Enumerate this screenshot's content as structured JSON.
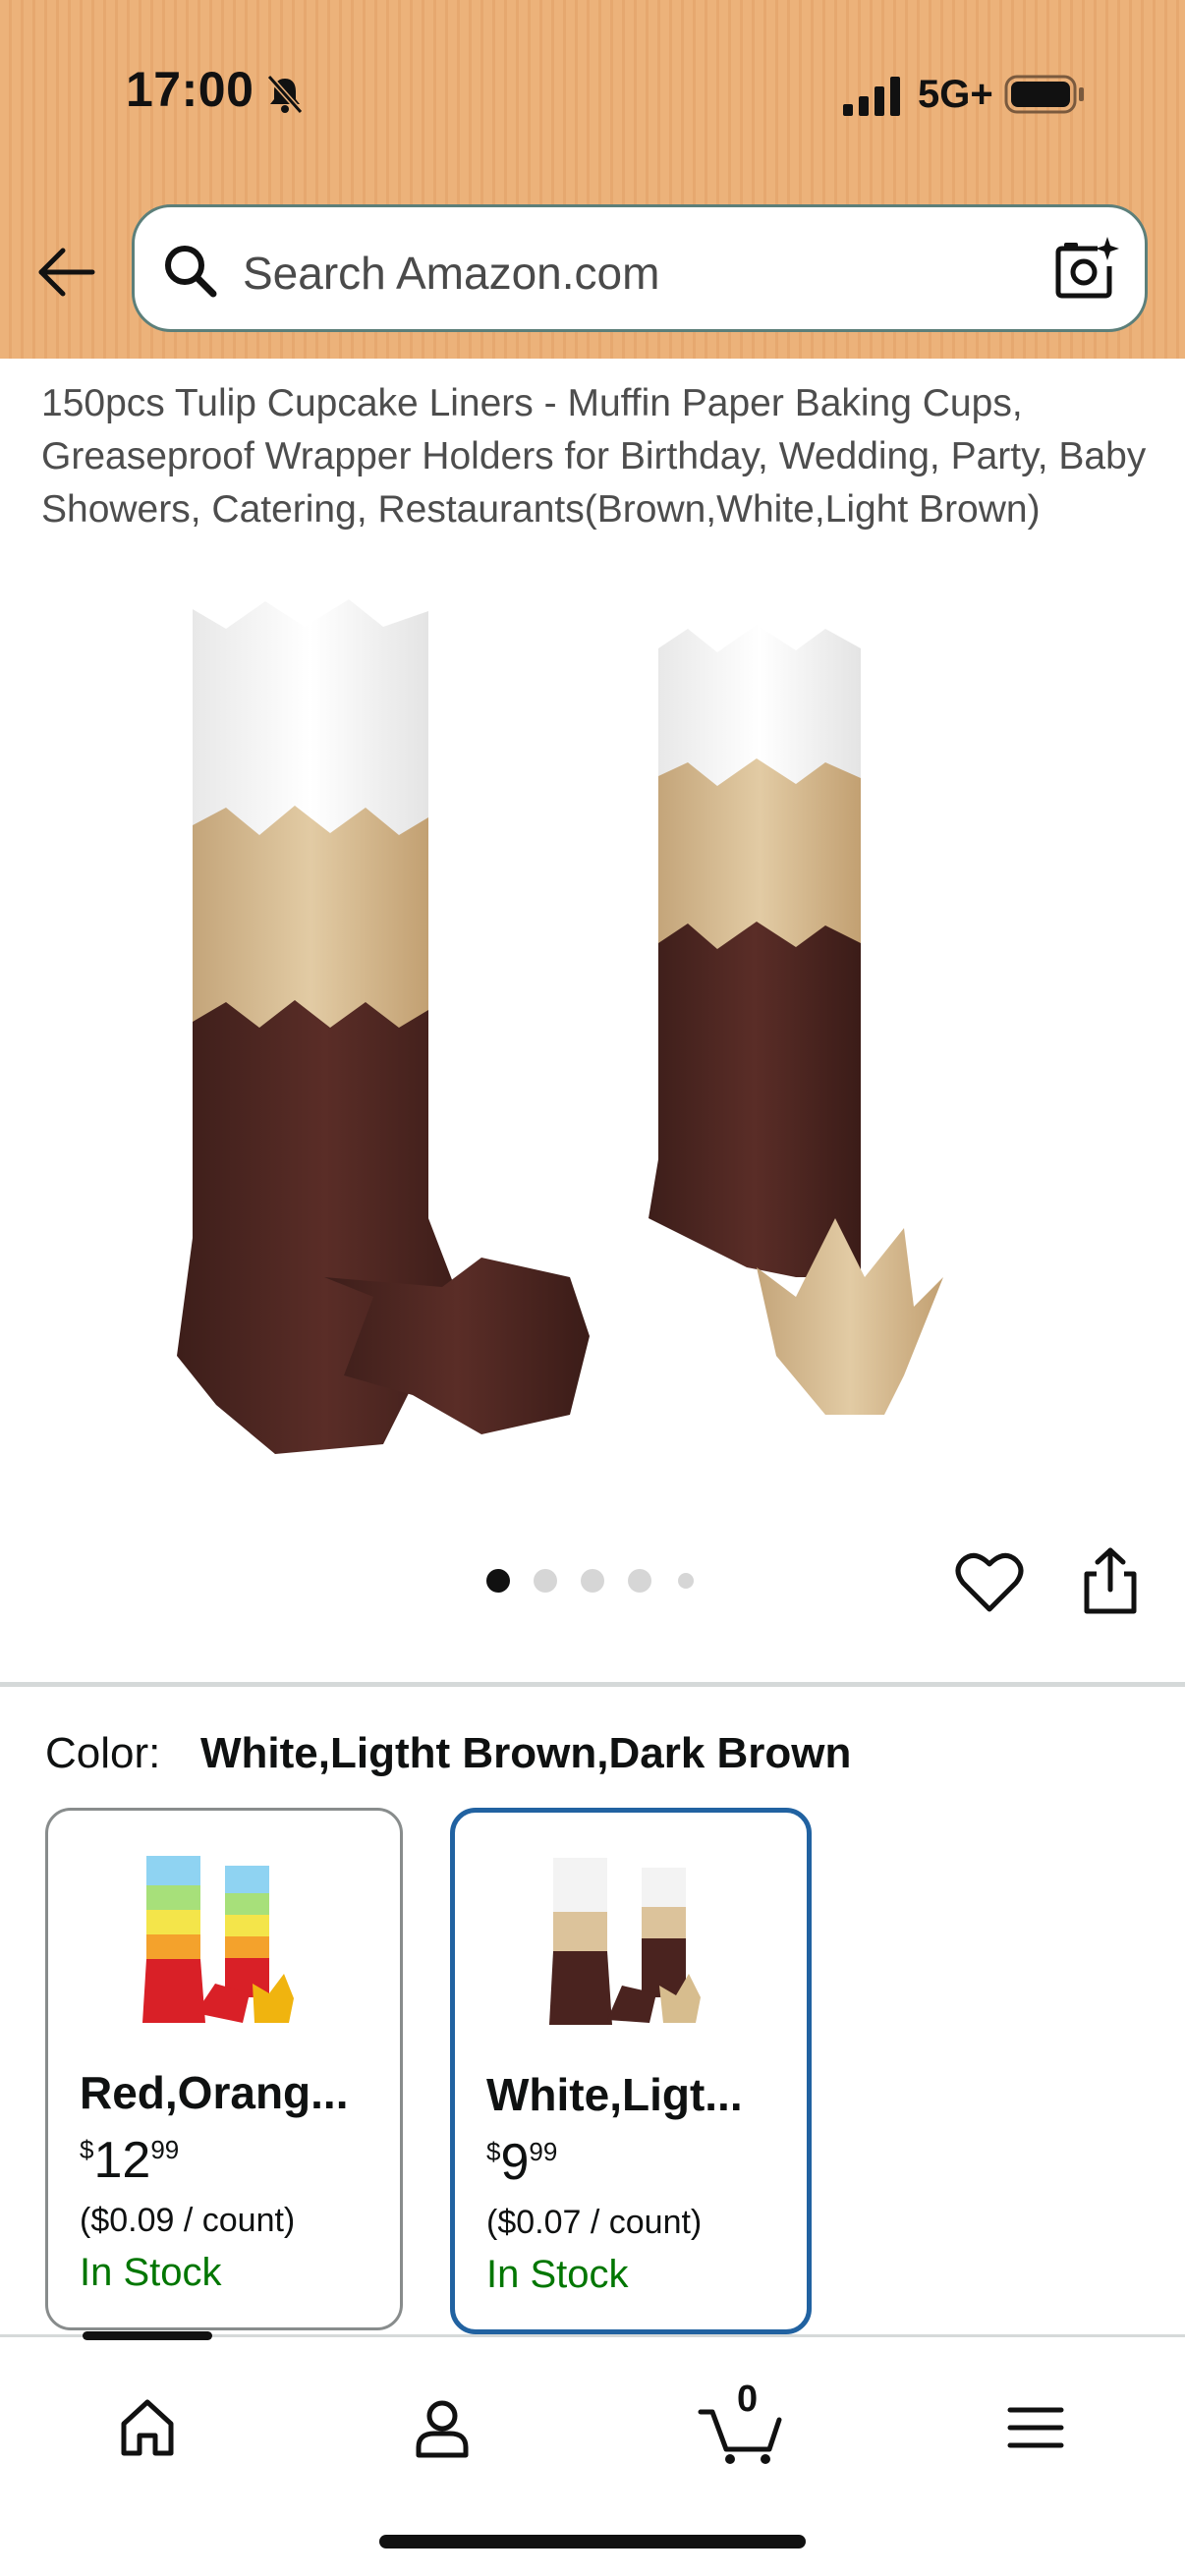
{
  "status_bar": {
    "time": "17:00",
    "network": "5G+",
    "icons": [
      "bell-muted-icon",
      "signal-icon",
      "battery-icon"
    ]
  },
  "header": {
    "search_placeholder": "Search Amazon.com",
    "icons": [
      "back-arrow-icon",
      "search-icon",
      "camera-search-icon"
    ],
    "background_color": "#ecb27a"
  },
  "product": {
    "title": "150pcs Tulip Cupcake Liners - Muffin Paper Baking Cups, Greaseproof Wrapper Holders for Birthday, Wedding, Party, Baby Showers, Catering, Restaurants(Brown,White,Light Brown)",
    "image_count": 5,
    "current_image": 1
  },
  "color": {
    "label": "Color:",
    "selected_value": "White,Ligtht Brown,Dark Brown",
    "options": [
      {
        "name": "Red,Orang...",
        "price_symbol": "$",
        "price_whole": "12",
        "price_fraction": "99",
        "unit_price": "($0.09 / count)",
        "stock": "In Stock",
        "selected": false
      },
      {
        "name": "White,Ligt...",
        "price_symbol": "$",
        "price_whole": "9",
        "price_fraction": "99",
        "unit_price": "($0.07 / count)",
        "stock": "In Stock",
        "selected": true
      }
    ]
  },
  "bottom_nav": {
    "items": [
      "home-icon",
      "account-icon",
      "cart-icon",
      "menu-icon"
    ],
    "cart_count": "0"
  },
  "colors": {
    "accent_selected": "#2162a1",
    "in_stock": "#007600"
  }
}
